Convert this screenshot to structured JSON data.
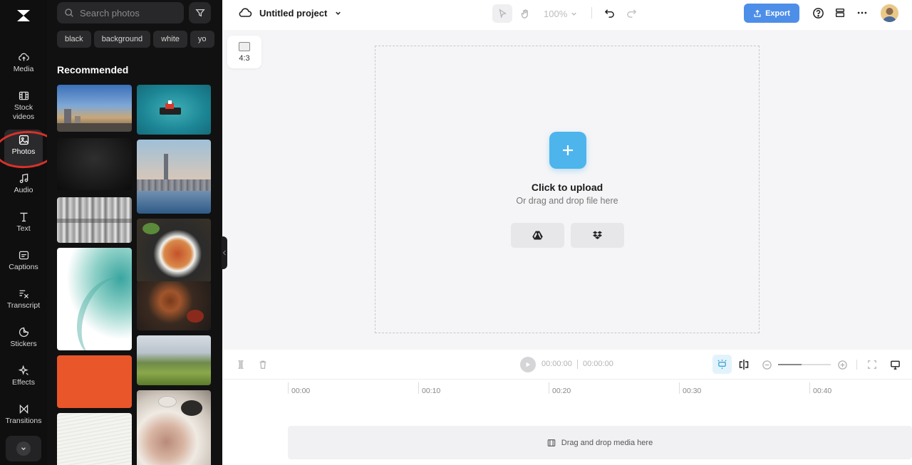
{
  "rail": {
    "items": [
      {
        "label": "Media",
        "icon": "cloud-upload-icon"
      },
      {
        "label": "Stock\nvideos",
        "icon": "film-icon"
      },
      {
        "label": "Photos",
        "icon": "image-icon"
      },
      {
        "label": "Audio",
        "icon": "music-note-icon"
      },
      {
        "label": "Text",
        "icon": "text-icon"
      },
      {
        "label": "Captions",
        "icon": "captions-icon"
      },
      {
        "label": "Transcript",
        "icon": "transcript-icon"
      },
      {
        "label": "Stickers",
        "icon": "sticker-icon"
      },
      {
        "label": "Effects",
        "icon": "sparkle-icon"
      },
      {
        "label": "Transitions",
        "icon": "transition-icon"
      }
    ]
  },
  "panel": {
    "search_placeholder": "Search photos",
    "chips": [
      "black",
      "background",
      "white",
      "yo"
    ],
    "recommended_title": "Recommended"
  },
  "header": {
    "project_title": "Untitled project",
    "zoom": "100%",
    "export_label": "Export"
  },
  "canvas": {
    "ratio_label": "4:3",
    "upload_title": "Click to upload",
    "upload_sub": "Or drag and drop file here"
  },
  "timeline": {
    "current_time": "00:00:00",
    "total_time": "00:00:00",
    "ticks": [
      "00:00",
      "00:10",
      "00:20",
      "00:30",
      "00:40"
    ],
    "drop_label": "Drag and drop media here"
  },
  "colors": {
    "accent": "#4d8fe8",
    "upload": "#4db4ec",
    "highlight_ring": "#d8312a"
  }
}
